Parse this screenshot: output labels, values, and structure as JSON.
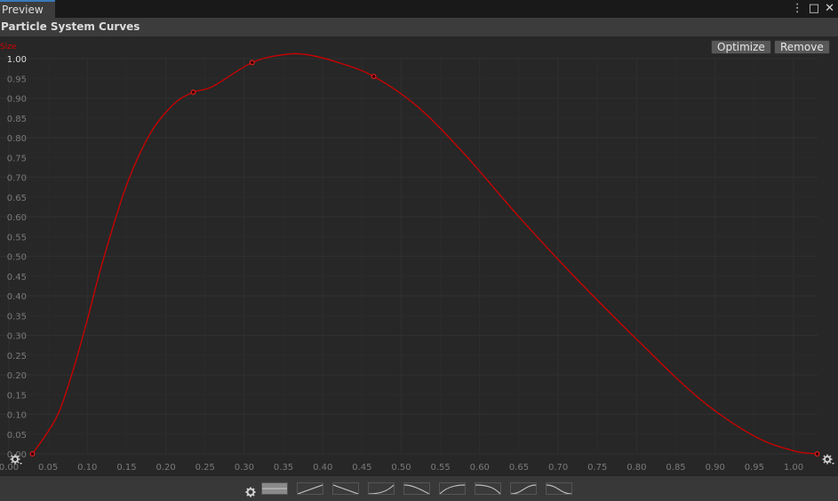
{
  "tab": {
    "label": "Preview"
  },
  "window_icons": {
    "menu": "⋮",
    "maximize": "□",
    "close": "✕"
  },
  "panel": {
    "title": "Particle System Curves"
  },
  "buttons": {
    "optimize": "Optimize",
    "remove": "Remove"
  },
  "curve": {
    "label": "Size",
    "color": "#d00000"
  },
  "chart_data": {
    "type": "line",
    "x_ticks": [
      "0.00",
      "0.05",
      "0.10",
      "0.15",
      "0.20",
      "0.25",
      "0.30",
      "0.35",
      "0.40",
      "0.45",
      "0.50",
      "0.55",
      "0.60",
      "0.65",
      "0.70",
      "0.75",
      "0.80",
      "0.85",
      "0.90",
      "0.95",
      "1.00"
    ],
    "y_ticks": [
      "0.00",
      "0.05",
      "0.10",
      "0.15",
      "0.20",
      "0.25",
      "0.30",
      "0.35",
      "0.40",
      "0.45",
      "0.50",
      "0.55",
      "0.60",
      "0.65",
      "0.70",
      "0.75",
      "0.80",
      "0.85",
      "0.90",
      "0.95",
      "1.00"
    ],
    "xlim": [
      0.0,
      1.05
    ],
    "ylim": [
      0.0,
      1.0
    ],
    "series": [
      {
        "name": "Size",
        "keys": [
          {
            "x": 0.03,
            "y": 0.0
          },
          {
            "x": 0.235,
            "y": 0.915
          },
          {
            "x": 0.31,
            "y": 0.99
          },
          {
            "x": 0.465,
            "y": 0.955
          },
          {
            "x": 1.03,
            "y": 0.0
          }
        ],
        "samples": [
          {
            "x": 0.03,
            "y": 0.0
          },
          {
            "x": 0.06,
            "y": 0.09
          },
          {
            "x": 0.08,
            "y": 0.2
          },
          {
            "x": 0.1,
            "y": 0.34
          },
          {
            "x": 0.12,
            "y": 0.49
          },
          {
            "x": 0.15,
            "y": 0.68
          },
          {
            "x": 0.18,
            "y": 0.81
          },
          {
            "x": 0.21,
            "y": 0.885
          },
          {
            "x": 0.235,
            "y": 0.915
          },
          {
            "x": 0.26,
            "y": 0.93
          },
          {
            "x": 0.31,
            "y": 0.99
          },
          {
            "x": 0.35,
            "y": 1.01
          },
          {
            "x": 0.38,
            "y": 1.01
          },
          {
            "x": 0.42,
            "y": 0.99
          },
          {
            "x": 0.465,
            "y": 0.955
          },
          {
            "x": 0.52,
            "y": 0.88
          },
          {
            "x": 0.58,
            "y": 0.76
          },
          {
            "x": 0.65,
            "y": 0.6
          },
          {
            "x": 0.72,
            "y": 0.45
          },
          {
            "x": 0.8,
            "y": 0.29
          },
          {
            "x": 0.88,
            "y": 0.14
          },
          {
            "x": 0.95,
            "y": 0.045
          },
          {
            "x": 1.0,
            "y": 0.008
          },
          {
            "x": 1.03,
            "y": 0.0
          }
        ]
      }
    ],
    "grid": true
  },
  "presets": [
    "constant",
    "linear-up",
    "linear-down",
    "ease-in",
    "ease-out-down",
    "ease-out",
    "ease-in-down",
    "ease-in-out",
    "ease-in-out-down"
  ]
}
